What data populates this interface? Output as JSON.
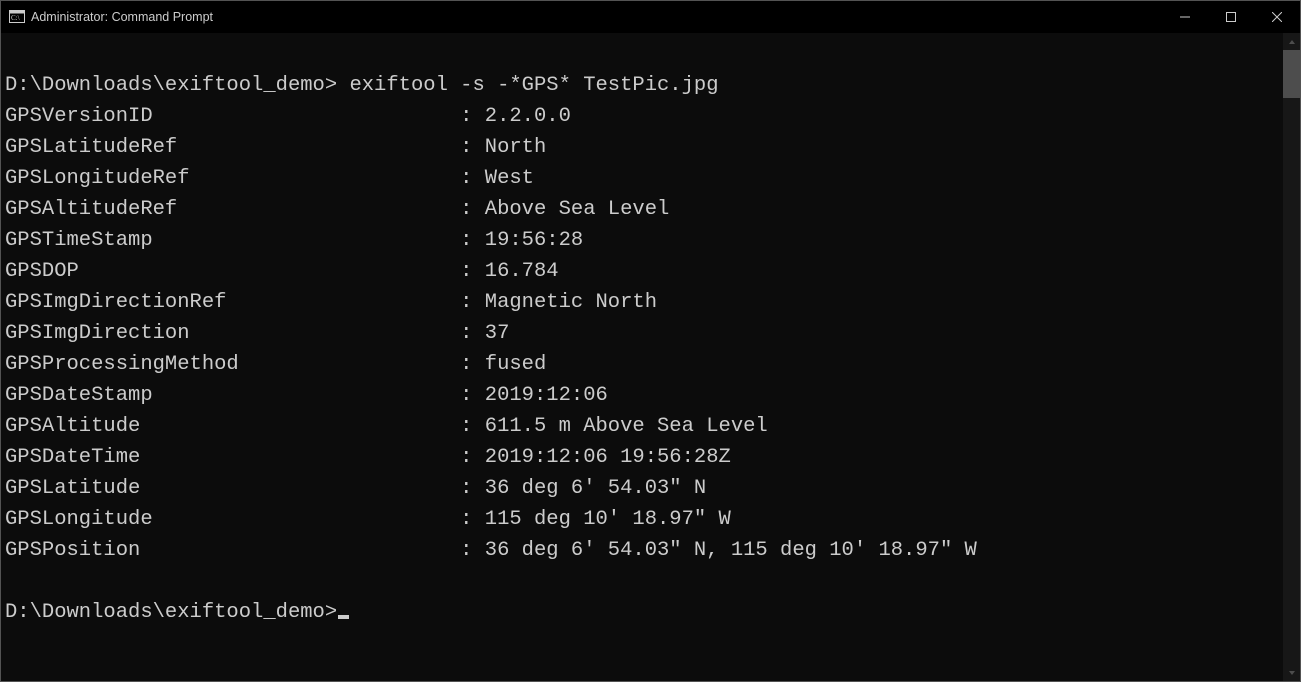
{
  "window": {
    "title": "Administrator: Command Prompt"
  },
  "terminal": {
    "blank_top": true,
    "prompt1_path": "D:\\Downloads\\exiftool_demo>",
    "prompt1_cmd": " exiftool -s -*GPS* TestPic.jpg",
    "rows": [
      {
        "key": "GPSVersionID",
        "value": "2.2.0.0"
      },
      {
        "key": "GPSLatitudeRef",
        "value": "North"
      },
      {
        "key": "GPSLongitudeRef",
        "value": "West"
      },
      {
        "key": "GPSAltitudeRef",
        "value": "Above Sea Level"
      },
      {
        "key": "GPSTimeStamp",
        "value": "19:56:28"
      },
      {
        "key": "GPSDOP",
        "value": "16.784"
      },
      {
        "key": "GPSImgDirectionRef",
        "value": "Magnetic North"
      },
      {
        "key": "GPSImgDirection",
        "value": "37"
      },
      {
        "key": "GPSProcessingMethod",
        "value": "fused"
      },
      {
        "key": "GPSDateStamp",
        "value": "2019:12:06"
      },
      {
        "key": "GPSAltitude",
        "value": "611.5 m Above Sea Level"
      },
      {
        "key": "GPSDateTime",
        "value": "2019:12:06 19:56:28Z"
      },
      {
        "key": "GPSLatitude",
        "value": "36 deg 6' 54.03\" N"
      },
      {
        "key": "GPSLongitude",
        "value": "115 deg 10' 18.97\" W"
      },
      {
        "key": "GPSPosition",
        "value": "36 deg 6' 54.03\" N, 115 deg 10' 18.97\" W"
      }
    ],
    "separator": ": ",
    "prompt2_path": "D:\\Downloads\\exiftool_demo>"
  }
}
